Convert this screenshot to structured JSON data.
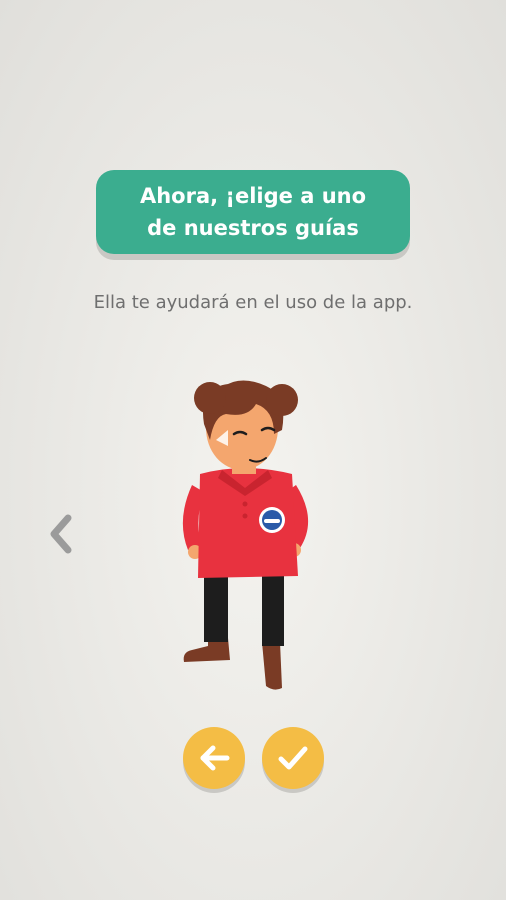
{
  "header": {
    "title": "Ahora, ¡elige a uno de nuestros guías",
    "subtitle": "Ella te ayudará en el uso de la app."
  },
  "guide": {
    "icon": "female-guide-illustration"
  },
  "navigation": {
    "prev_icon": "chevron-left-icon"
  },
  "actions": {
    "back_icon": "arrow-left-icon",
    "confirm_icon": "check-icon"
  },
  "colors": {
    "banner": "#3bad8f",
    "button": "#f4bd45",
    "shirt": "#e8323f",
    "hair": "#7a3b25"
  }
}
